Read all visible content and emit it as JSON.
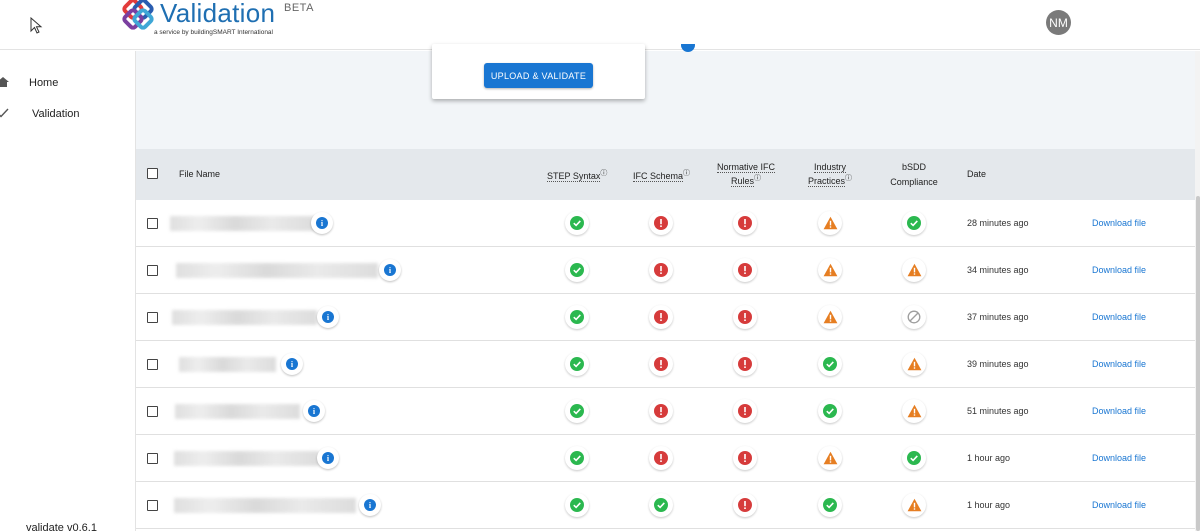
{
  "header": {
    "logo_title": "Validation",
    "logo_subtitle": "a service by buildingSMART International",
    "beta_label": "BETA",
    "avatar_initials": "NM"
  },
  "sidebar": {
    "items": [
      {
        "label": "Home",
        "icon": "home-icon"
      },
      {
        "label": "Validation",
        "icon": "check-icon"
      }
    ],
    "version": "validate v0.6.1"
  },
  "upload": {
    "button_label": "UPLOAD & VALIDATE"
  },
  "table": {
    "columns": {
      "file_name": "File Name",
      "step_syntax": "STEP Syntax",
      "ifc_schema": "IFC Schema",
      "normative_line1": "Normative IFC",
      "normative_line2": "Rules",
      "industry_line1": "Industry",
      "industry_line2": "Practices",
      "bsdd_line1": "bSDD",
      "bsdd_line2": "Compliance",
      "date": "Date"
    },
    "download_label": "Download file",
    "rows": [
      {
        "step": "valid",
        "schema": "invalid",
        "normative": "invalid",
        "industry": "warning",
        "bsdd": "valid",
        "date": "28 minutes ago"
      },
      {
        "step": "valid",
        "schema": "invalid",
        "normative": "invalid",
        "industry": "warning",
        "bsdd": "warning",
        "date": "34 minutes ago"
      },
      {
        "step": "valid",
        "schema": "invalid",
        "normative": "invalid",
        "industry": "warning",
        "bsdd": "not-applicable",
        "date": "37 minutes ago"
      },
      {
        "step": "valid",
        "schema": "invalid",
        "normative": "invalid",
        "industry": "valid",
        "bsdd": "warning",
        "date": "39 minutes ago"
      },
      {
        "step": "valid",
        "schema": "invalid",
        "normative": "invalid",
        "industry": "valid",
        "bsdd": "warning",
        "date": "51 minutes ago"
      },
      {
        "step": "valid",
        "schema": "invalid",
        "normative": "invalid",
        "industry": "warning",
        "bsdd": "valid",
        "date": "1 hour ago"
      },
      {
        "step": "valid",
        "schema": "valid",
        "normative": "invalid",
        "industry": "valid",
        "bsdd": "warning",
        "date": "1 hour ago"
      }
    ]
  },
  "colors": {
    "accent": "#1976d2",
    "valid": "#2bb84f",
    "invalid": "#d63b3b",
    "warning": "#e67e22",
    "not_applicable": "#9e9e9e"
  }
}
